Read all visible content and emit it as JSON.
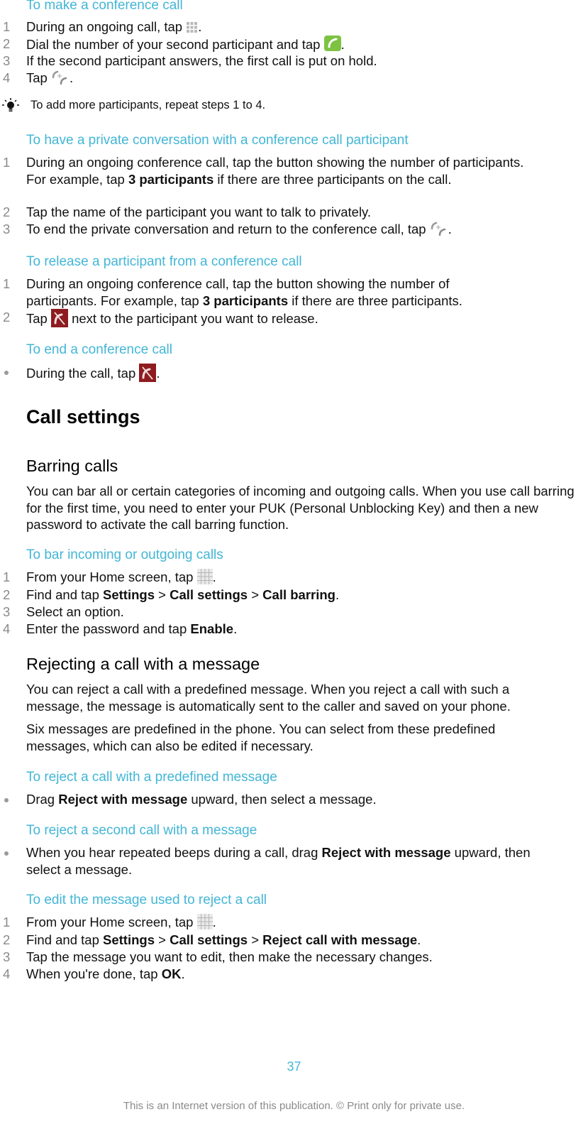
{
  "sections": {
    "make_conference": {
      "title": "To make a conference call",
      "steps": [
        {
          "num": "1",
          "before": "During an ongoing call, tap ",
          "after": "."
        },
        {
          "num": "2",
          "before": "Dial the number of your second participant and tap ",
          "after": "."
        },
        {
          "num": "3",
          "text": "If the second participant answers, the first call is put on hold."
        },
        {
          "num": "4",
          "before": "Tap ",
          "after": "."
        }
      ],
      "tip": "To add more participants, repeat steps 1 to 4."
    },
    "private_conversation": {
      "title": "To have a private conversation with a conference call participant",
      "steps": [
        {
          "num": "1",
          "before": "During an ongoing conference call, tap the button showing the number of participants. For example, tap ",
          "bold": "3 participants",
          "after": " if there are three participants on the call."
        },
        {
          "num": "2",
          "text": "Tap the name of the participant you want to talk to privately."
        },
        {
          "num": "3",
          "before": "To end the private conversation and return to the conference call, tap ",
          "after": "."
        }
      ]
    },
    "release_participant": {
      "title": "To release a participant from a conference call",
      "steps": [
        {
          "num": "1",
          "before": "During an ongoing conference call, tap the button showing the number of participants. For example, tap ",
          "bold": "3 participants",
          "after": " if there are three participants."
        },
        {
          "num": "2",
          "before": "Tap ",
          "after": " next to the participant you want to release."
        }
      ]
    },
    "end_conference": {
      "title": "To end a conference call",
      "steps": [
        {
          "before": "During the call, tap ",
          "after": "."
        }
      ]
    },
    "call_settings": {
      "heading": "Call settings"
    },
    "barring_calls": {
      "heading": "Barring calls",
      "paragraph": "You can bar all or certain categories of incoming and outgoing calls. When you use call barring for the first time, you need to enter your PUK (Personal Unblocking Key) and then a new password to activate the call barring function."
    },
    "bar_calls_task": {
      "title": "To bar incoming or outgoing calls",
      "steps": [
        {
          "num": "1",
          "before": "From your Home screen, tap ",
          "after": "."
        },
        {
          "num": "2",
          "before": "Find and tap ",
          "b1": "Settings",
          "sep1": " > ",
          "b2": "Call settings",
          "sep2": " > ",
          "b3": "Call barring",
          "after": "."
        },
        {
          "num": "3",
          "text": "Select an option."
        },
        {
          "num": "4",
          "before": "Enter the password and tap ",
          "bold": "Enable",
          "after": "."
        }
      ]
    },
    "rejecting": {
      "heading": "Rejecting a call with a message",
      "paragraph1": "You can reject a call with a predefined message. When you reject a call with such a message, the message is automatically sent to the caller and saved on your phone.",
      "paragraph2": "Six messages are predefined in the phone. You can select from these predefined messages, which can also be edited if necessary."
    },
    "reject_predefined": {
      "title": "To reject a call with a predefined message",
      "steps": [
        {
          "before": "Drag ",
          "bold": "Reject with message",
          "after": " upward, then select a message."
        }
      ]
    },
    "reject_second": {
      "title": "To reject a second call with a message",
      "steps": [
        {
          "before": "When you hear repeated beeps during a call, drag ",
          "bold": "Reject with message",
          "after": " upward, then select a message."
        }
      ]
    },
    "edit_message": {
      "title": "To edit the message used to reject a call",
      "steps": [
        {
          "num": "1",
          "before": "From your Home screen, tap ",
          "after": "."
        },
        {
          "num": "2",
          "before": "Find and tap ",
          "b1": "Settings",
          "sep1": " > ",
          "b2": "Call settings",
          "sep2": " > ",
          "b3": "Reject call with message",
          "after": "."
        },
        {
          "num": "3",
          "text": "Tap the message you want to edit, then make the necessary changes."
        },
        {
          "num": "4",
          "before": "When you're done, tap ",
          "bold": "OK",
          "after": "."
        }
      ]
    }
  },
  "icons": {
    "dialpad": "dialpad-icon",
    "call_green": "call-icon",
    "merge_calls": "merge-calls-icon",
    "end_call_red": "end-call-icon",
    "app_grid": "app-grid-icon",
    "tip_bulb": "lightbulb-icon"
  },
  "colors": {
    "accent": "#43b6d6",
    "call_green": "#7dc242",
    "end_call_red": "#8e1b1f",
    "step_number": "#8a8a8a"
  },
  "footer": {
    "page_number": "37",
    "notice": "This is an Internet version of this publication. © Print only for private use."
  }
}
